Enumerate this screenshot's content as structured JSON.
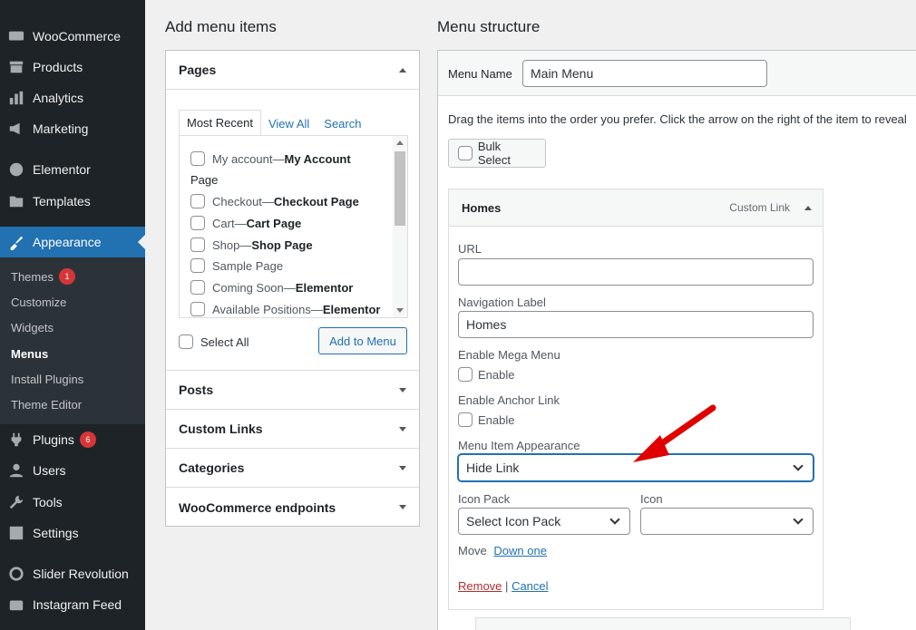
{
  "sidebar": {
    "items": [
      {
        "label": "WooCommerce",
        "icon": "woo-icon"
      },
      {
        "label": "Products",
        "icon": "archive-icon"
      },
      {
        "label": "Analytics",
        "icon": "bar-chart-icon"
      },
      {
        "label": "Marketing",
        "icon": "megaphone-icon"
      },
      {
        "label": "Elementor",
        "icon": "elementor-icon"
      },
      {
        "label": "Templates",
        "icon": "folder-icon"
      },
      {
        "label": "Appearance",
        "icon": "paintbrush-icon"
      },
      {
        "label": "Plugins",
        "icon": "plug-icon",
        "badge": "6"
      },
      {
        "label": "Users",
        "icon": "user-icon"
      },
      {
        "label": "Tools",
        "icon": "wrench-icon"
      },
      {
        "label": "Settings",
        "icon": "sliders-icon"
      },
      {
        "label": "Slider Revolution",
        "icon": "refresh-icon"
      },
      {
        "label": "Instagram Feed",
        "icon": "camera-icon"
      }
    ],
    "submenu": [
      {
        "label": "Themes",
        "badge": "1"
      },
      {
        "label": "Customize"
      },
      {
        "label": "Widgets"
      },
      {
        "label": "Menus"
      },
      {
        "label": "Install Plugins"
      },
      {
        "label": "Theme Editor"
      }
    ]
  },
  "add_menu_items": {
    "heading": "Add menu items",
    "pages_title": "Pages",
    "tabs": [
      "Most Recent",
      "View All",
      "Search"
    ],
    "pages": [
      {
        "name": "My account",
        "sep": " — ",
        "state": "My Account"
      },
      {
        "name": "Page",
        "sep": "",
        "state": ""
      },
      {
        "name": "Checkout",
        "sep": " — ",
        "state": "Checkout Page"
      },
      {
        "name": "Cart",
        "sep": " — ",
        "state": "Cart Page"
      },
      {
        "name": "Shop",
        "sep": " — ",
        "state": "Shop Page"
      },
      {
        "name": "Sample Page",
        "sep": "",
        "state": ""
      },
      {
        "name": "Coming Soon",
        "sep": " — ",
        "state": "Elementor"
      },
      {
        "name": "Available Positions",
        "sep": " — ",
        "state": "Elementor"
      }
    ],
    "select_all": "Select All",
    "add_button": "Add to Menu",
    "sections": [
      "Posts",
      "Custom Links",
      "Categories",
      "WooCommerce endpoints"
    ]
  },
  "menu_structure": {
    "heading": "Menu structure",
    "menu_name_label": "Menu Name",
    "menu_name_value": "Main Menu",
    "instructions": "Drag the items into the order you prefer. Click the arrow on the right of the item to reveal",
    "bulk_select": "Bulk Select",
    "item": {
      "title": "Homes",
      "type": "Custom Link",
      "url_label": "URL",
      "url_value": "",
      "nav_label_label": "Navigation Label",
      "nav_label_value": "Homes",
      "mega_menu_label": "Enable Mega Menu",
      "mega_menu_cb": "Enable",
      "anchor_label": "Enable Anchor Link",
      "anchor_cb": "Enable",
      "appearance_label": "Menu Item Appearance",
      "appearance_value": "Hide Link",
      "icon_pack_label": "Icon Pack",
      "icon_pack_value": "Select Icon Pack",
      "icon_label": "Icon",
      "icon_value": "",
      "move_label": "Move",
      "move_link": "Down one",
      "remove": "Remove",
      "divider": "|",
      "cancel": "Cancel"
    }
  },
  "colors": {
    "accent": "#2271b1",
    "sidebar": "#1d2327",
    "badge": "#d63638",
    "arrow": "#e00000"
  }
}
